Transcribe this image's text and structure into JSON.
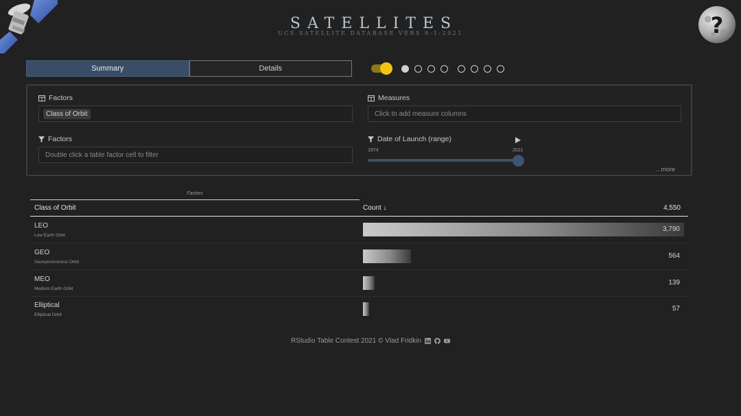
{
  "header": {
    "title": "SATELLITES",
    "subtitle": "UCS SATELLITE DATABASE VERS 9-1-2021",
    "logo_icon": "satellite-icon",
    "help_icon": "moon-question-icon"
  },
  "tabs": [
    {
      "label": "Summary",
      "active": true
    },
    {
      "label": "Details",
      "active": false
    }
  ],
  "toggle": {
    "on": true,
    "color": "#f3c414"
  },
  "dots": {
    "filled_index": 0,
    "count": 8
  },
  "settings": {
    "factors": {
      "label": "Factors",
      "chip": "Class of Orbit"
    },
    "measures": {
      "label": "Measures",
      "placeholder": "Click to add measure columns"
    },
    "filter": {
      "label": "Factors",
      "placeholder": "Double click a table factor cell to filter"
    },
    "date_range": {
      "label": "Date of Launch (range)",
      "min": "1974",
      "max": "2021"
    },
    "more": "...more"
  },
  "table": {
    "group_caption": "Factors",
    "col_factor": "Class of Orbit",
    "col_count": "Count ↓",
    "total": "4,550",
    "max_value": 3790,
    "rows": [
      {
        "name": "LEO",
        "desc": "Low Earth Orbit",
        "value": 3790,
        "label": "3,790"
      },
      {
        "name": "GEO",
        "desc": "Geosynchronous Orbit",
        "value": 564,
        "label": "564"
      },
      {
        "name": "MEO",
        "desc": "Medium Earth Orbit",
        "value": 139,
        "label": "139"
      },
      {
        "name": "Elliptical",
        "desc": "Elliptical Orbit",
        "value": 57,
        "label": "57"
      }
    ]
  },
  "footer": {
    "text": "RStudio Table Contest 2021 © Vlad Fridkin",
    "icons": [
      "linkedin-icon",
      "github-icon",
      "youtube-icon"
    ]
  }
}
